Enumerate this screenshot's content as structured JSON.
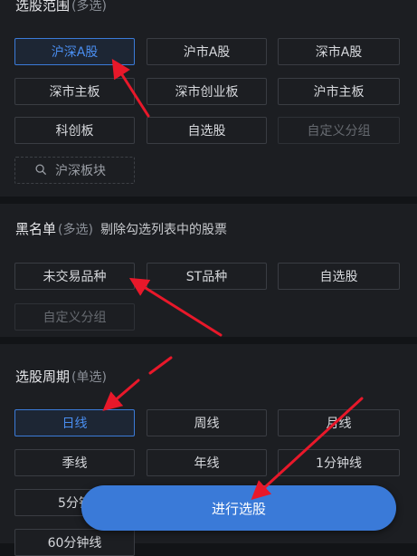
{
  "range_section": {
    "title": "选股范围",
    "hint": "(多选)",
    "options": [
      "沪深A股",
      "沪市A股",
      "深市A股",
      "深市主板",
      "深市创业板",
      "沪市主板",
      "科创板",
      "自选股",
      "自定义分组"
    ],
    "search_label": "沪深板块"
  },
  "blacklist_section": {
    "title": "黑名单",
    "hint": "(多选)",
    "description": "剔除勾选列表中的股票",
    "options": [
      "未交易品种",
      "ST品种",
      "自选股",
      "自定义分组"
    ]
  },
  "period_section": {
    "title": "选股周期",
    "hint": "(单选)",
    "options": [
      "日线",
      "周线",
      "月线",
      "季线",
      "年线",
      "1分钟线",
      "5分钟",
      "60分钟线"
    ]
  },
  "submit_label": "进行选股",
  "colors": {
    "accent": "#3b7bd8",
    "background": "#121417",
    "panel": "#1c1e22",
    "arrow": "#e8182a"
  }
}
